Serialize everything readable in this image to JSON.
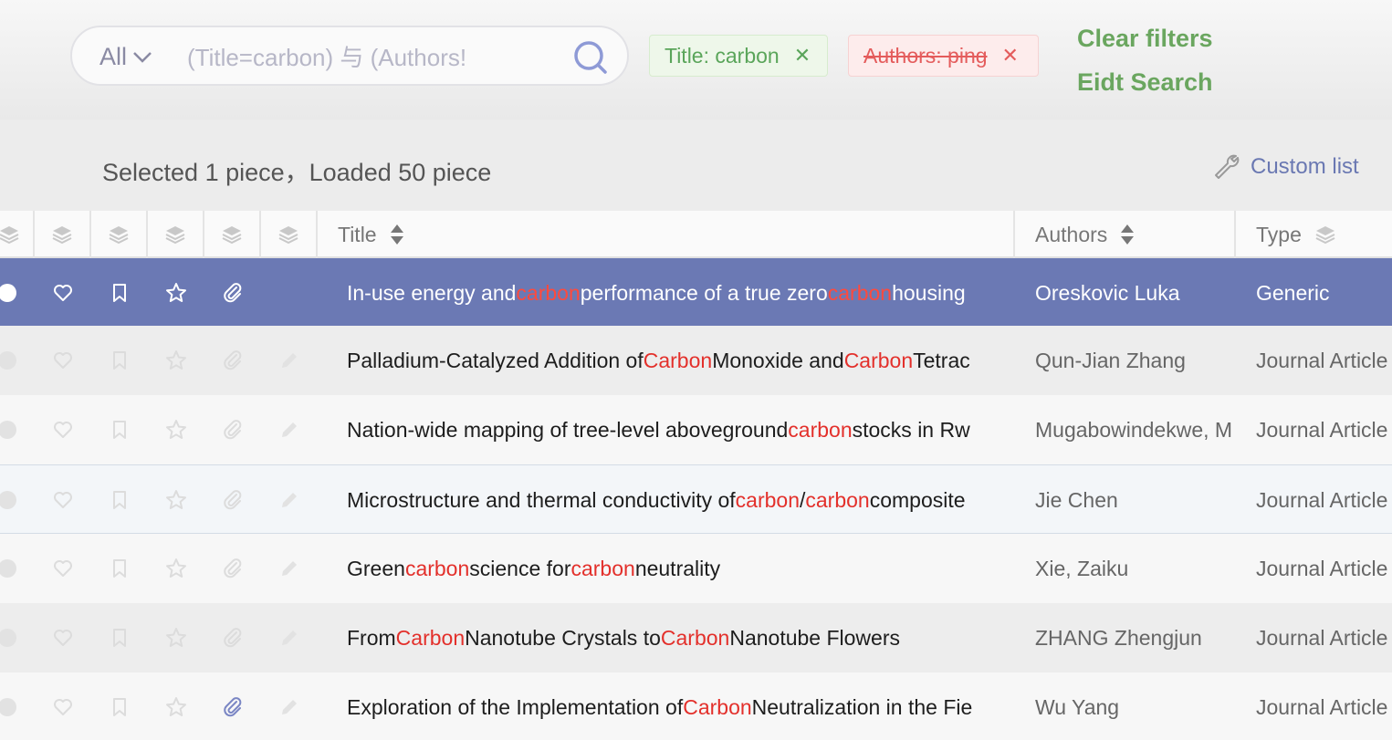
{
  "search": {
    "scope": "All",
    "placeholder": "(Title=carbon) 与 (Authors!"
  },
  "filters": [
    {
      "label": "Title: carbon",
      "state": "active",
      "color": "#5aa55a"
    },
    {
      "label": "Authors: ping",
      "state": "excluded",
      "color": "#e45c5c"
    }
  ],
  "actions": {
    "clear_filters": "Clear filters",
    "edit_search": "Eidt Search"
  },
  "status": {
    "count_text": "Selected 1 piece，Loaded 50 piece",
    "custom_list": "Custom list"
  },
  "columns": {
    "title": "Title",
    "authors": "Authors",
    "type": "Type"
  },
  "colors": {
    "accent": "#6b79b4",
    "highlight": "#e3302b",
    "link": "#6aa65f"
  },
  "rows": [
    {
      "title_parts": [
        "In-use energy and ",
        "carbon",
        " performance of a true zero ",
        "carbon",
        " housing"
      ],
      "authors": "Oreskovic Luka",
      "type": "Generic",
      "has_attachment": true
    },
    {
      "title_parts": [
        "Palladium-Catalyzed Addition of ",
        "Carbon",
        " Monoxide and ",
        "Carbon",
        " Tetrac"
      ],
      "authors": "Qun-Jian Zhang",
      "type": "Journal Article",
      "has_attachment": false
    },
    {
      "title_parts": [
        "Nation-wide mapping of tree-level aboveground ",
        "carbon",
        " stocks in Rw"
      ],
      "authors": "Mugabowindekwe, M",
      "type": "Journal Article",
      "has_attachment": false
    },
    {
      "title_parts": [
        "Microstructure and thermal conductivity of ",
        "carbon",
        "/",
        "carbon",
        " composite"
      ],
      "authors": "Jie Chen",
      "type": "Journal Article",
      "has_attachment": false
    },
    {
      "title_parts": [
        "Green ",
        "carbon",
        " science for ",
        "carbon",
        " neutrality"
      ],
      "authors": "Xie, Zaiku",
      "type": "Journal Article",
      "has_attachment": false
    },
    {
      "title_parts": [
        "From ",
        "Carbon",
        " Nanotube Crystals to ",
        "Carbon",
        " Nanotube Flowers"
      ],
      "authors": "ZHANG Zhengjun",
      "type": "Journal Article",
      "has_attachment": false
    },
    {
      "title_parts": [
        "Exploration of the Implementation of ",
        "Carbon",
        " Neutralization in the Fie"
      ],
      "authors": "Wu Yang",
      "type": "Journal Article",
      "has_attachment": true
    }
  ]
}
